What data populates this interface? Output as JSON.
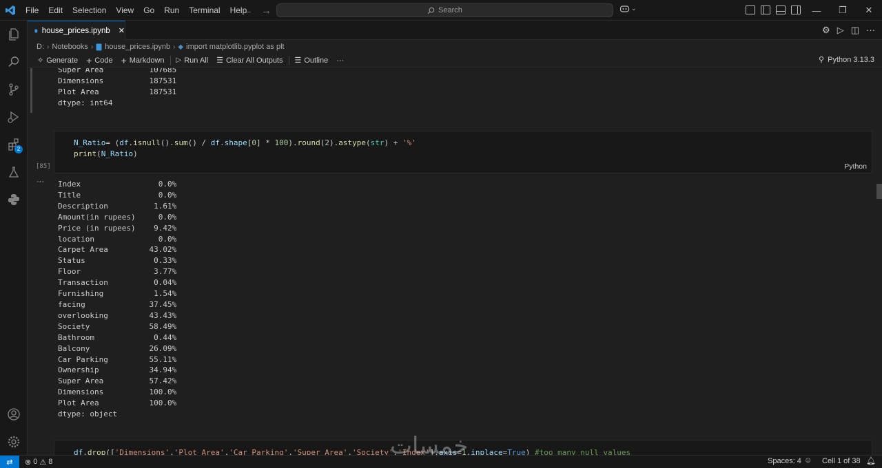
{
  "menu": [
    "File",
    "Edit",
    "Selection",
    "View",
    "Go",
    "Run",
    "Terminal",
    "Help"
  ],
  "search": {
    "placeholder": "Search"
  },
  "tab": {
    "label": "house_prices.ipynb"
  },
  "breadcrumb": {
    "drive": "D:",
    "folder": "Notebooks",
    "file": "house_prices.ipynb",
    "symbol": "import matplotlib.pyplot as plt"
  },
  "toolbar": {
    "generate": "Generate",
    "code": "Code",
    "markdown": "Markdown",
    "run_all": "Run All",
    "clear_outputs": "Clear All Outputs",
    "outline": "Outline",
    "more": "···"
  },
  "kernel": {
    "label": "Python 3.13.3"
  },
  "top_output": "Super Area          107685\nDimensions          187531\nPlot Area           187531\ndtype: int64",
  "cell1": {
    "line1": "N_Ratio= (df.isnull().sum() / df.shape[0] * 100).round(2).astype(str) + '%'",
    "line2": "print(N_Ratio)",
    "exec_count": "[85]",
    "language": "Python",
    "output_menu": "···"
  },
  "cell1_output": "Index                 0.0%\nTitle                 0.0%\nDescription          1.61%\nAmount(in rupees)     0.0%\nPrice (in rupees)    9.42%\nlocation              0.0%\nCarpet Area         43.02%\nStatus               0.33%\nFloor                3.77%\nTransaction          0.04%\nFurnishing           1.54%\nfacing              37.45%\noverlooking         43.43%\nSociety             58.49%\nBathroom             0.44%\nBalcony             26.09%\nCar Parking         55.11%\nOwnership           34.94%\nSuper Area          57.42%\nDimensions          100.0%\nPlot Area           100.0%\ndtype: object",
  "cell2": {
    "line1": "df.drop(['Dimensions','Plot Area','Car Parking','Super Area','Society','Index'],axis=1,inplace=True) #too many null values"
  },
  "status": {
    "errors": "0",
    "warnings": "8",
    "spaces": "Spaces: 4",
    "cell_pos": "Cell 1 of 38"
  },
  "watermark": "خمسات",
  "activity_badge": "2",
  "colors": {
    "accent": "#0078d4",
    "keyword": "#569cd6",
    "string": "#ce9178",
    "function": "#dcdcaa",
    "variable": "#9cdcfe",
    "comment": "#6a9955",
    "number": "#b5cea8"
  }
}
